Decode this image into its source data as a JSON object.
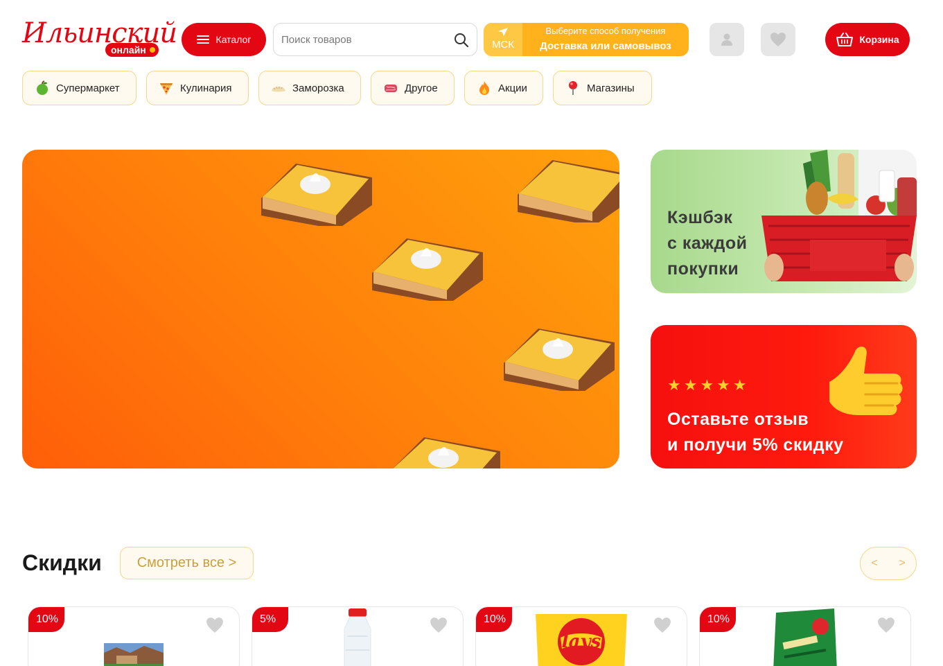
{
  "header": {
    "logo_script": "Ильинский",
    "logo_badge": "онлайн",
    "catalog_label": "Каталог",
    "search_placeholder": "Поиск товаров",
    "city": "МСК",
    "delivery_hint": "Выберите способ получения",
    "delivery_action": "Доставка или самовывоз",
    "cart_label": "Корзина"
  },
  "categories": [
    {
      "label": "Супермаркет",
      "icon": "green-apple-icon"
    },
    {
      "label": "Кулинария",
      "icon": "pizza-slice-icon"
    },
    {
      "label": "Заморозка",
      "icon": "dumpling-icon"
    },
    {
      "label": "Другое",
      "icon": "meat-icon"
    },
    {
      "label": "Акции",
      "icon": "fire-icon"
    },
    {
      "label": "Магазины",
      "icon": "map-pin-icon"
    }
  ],
  "banners": {
    "cashback_line1": "Кэшбэк",
    "cashback_line2": "с каждой",
    "cashback_line3": "покупки",
    "review_stars": "★★★★★",
    "review_line1": "Оставьте  отзыв",
    "review_line2": "и получи 5% скидку"
  },
  "discounts": {
    "title": "Скидки",
    "see_all": "Смотреть все >",
    "prev": "<",
    "next": ">",
    "products": [
      {
        "badge": "10%",
        "image": "milk-carton-product"
      },
      {
        "badge": "5%",
        "image": "water-bottle-product"
      },
      {
        "badge": "10%",
        "image": "lays-chips-product"
      },
      {
        "badge": "10%",
        "image": "tea-pack-product"
      }
    ]
  },
  "colors": {
    "brand_red": "#e30613",
    "delivery_orange": "#ffb21c",
    "chip_border": "#f3d78b",
    "banner_orange": "#ff7f0a"
  }
}
